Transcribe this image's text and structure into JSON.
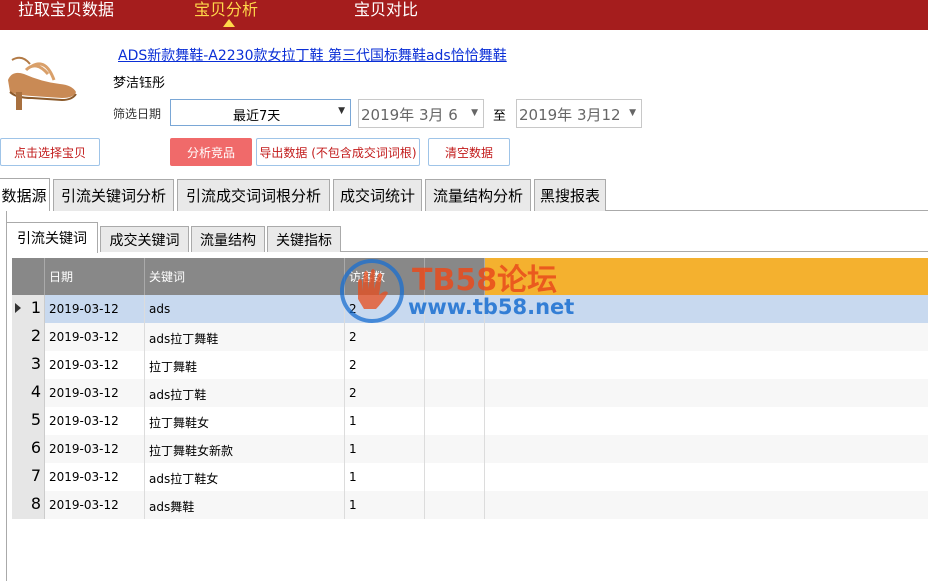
{
  "top_nav": {
    "items": [
      "拉取宝贝数据",
      "宝贝分析",
      "宝贝对比"
    ],
    "active": "宝贝分析"
  },
  "product": {
    "title": "ADS新款舞鞋-A2230款女拉丁鞋 第三代国标舞鞋ads恰恰舞鞋",
    "shop": "梦洁钰彤",
    "image_icon": "dance-shoe-image"
  },
  "filter": {
    "label": "筛选日期",
    "period": "最近7天",
    "date_from": "2019年  3月  6",
    "to_label": "至",
    "date_to": "2019年  3月12"
  },
  "buttons": {
    "select_item": "点击选择宝贝",
    "analyze": "分析竞品",
    "export": "导出数据 (不包含成交词词根)",
    "clear": "清空数据"
  },
  "main_tabs": [
    "数据源",
    "引流关键词分析",
    "引流成交词词根分析",
    "成交词统计",
    "流量结构分析",
    "黑搜报表"
  ],
  "main_tab_active": "数据源",
  "sub_tabs": [
    "引流关键词",
    "成交关键词",
    "流量结构",
    "关键指标"
  ],
  "sub_tab_active": "引流关键词",
  "table": {
    "columns": [
      "日期",
      "关键词",
      "访客数",
      "",
      ""
    ],
    "rows": [
      {
        "n": "1",
        "date": "2019-03-12",
        "keyword": "ads",
        "visitors": "2"
      },
      {
        "n": "2",
        "date": "2019-03-12",
        "keyword": "ads拉丁舞鞋",
        "visitors": "2"
      },
      {
        "n": "3",
        "date": "2019-03-12",
        "keyword": "拉丁舞鞋",
        "visitors": "2"
      },
      {
        "n": "4",
        "date": "2019-03-12",
        "keyword": "ads拉丁鞋",
        "visitors": "2"
      },
      {
        "n": "5",
        "date": "2019-03-12",
        "keyword": "拉丁舞鞋女",
        "visitors": "1"
      },
      {
        "n": "6",
        "date": "2019-03-12",
        "keyword": "拉丁舞鞋女新款",
        "visitors": "1"
      },
      {
        "n": "7",
        "date": "2019-03-12",
        "keyword": "ads拉丁鞋女",
        "visitors": "1"
      },
      {
        "n": "8",
        "date": "2019-03-12",
        "keyword": "ads舞鞋",
        "visitors": "1"
      }
    ],
    "selected_row": 1
  },
  "watermark": {
    "title": "TB58论坛",
    "url": "www.tb58.net"
  },
  "colors": {
    "topbar": "#a51d1d",
    "active_nav": "#ffd84a",
    "header_bg": "#f4b12f",
    "selected_row": "#c8d9ef",
    "button_red": "#f06a6a"
  }
}
